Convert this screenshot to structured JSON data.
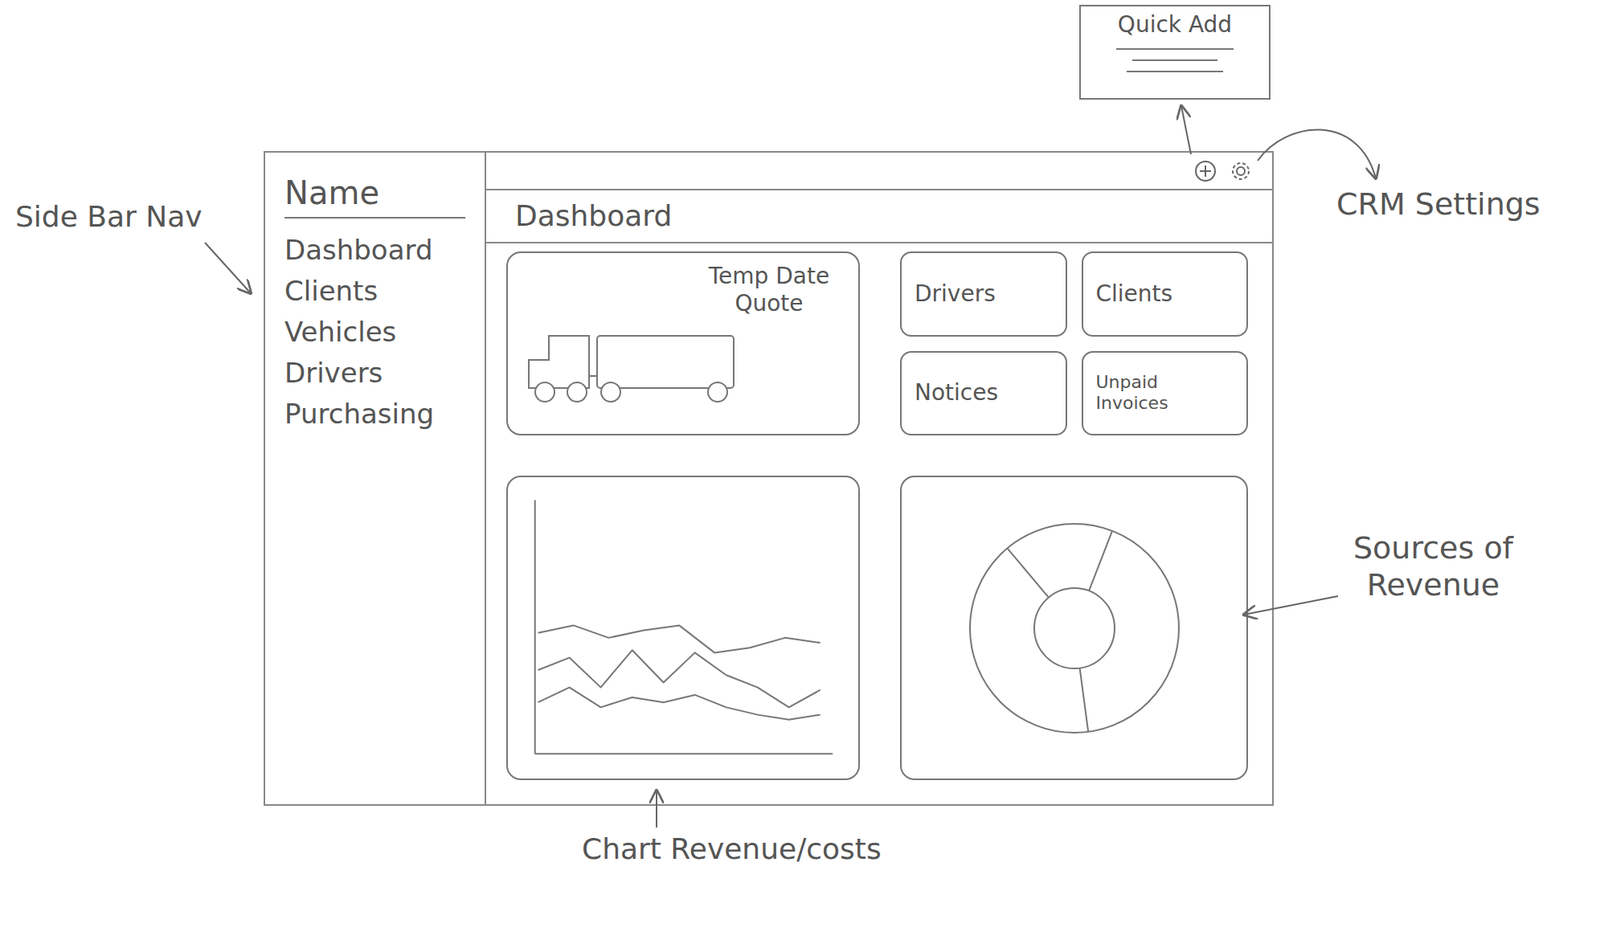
{
  "quick_add": {
    "title": "Quick Add"
  },
  "annotations": {
    "sidebar_nav": "Side Bar Nav",
    "crm_settings": "CRM Settings",
    "revenue_sources": "Sources of Revenue",
    "revenue_chart": "Chart Revenue/costs"
  },
  "sidebar": {
    "title": "Name",
    "items": [
      {
        "label": "Dashboard"
      },
      {
        "label": "Clients"
      },
      {
        "label": "Vehicles"
      },
      {
        "label": "Drivers"
      },
      {
        "label": "Purchasing"
      }
    ]
  },
  "header": {
    "title": "Dashboard"
  },
  "quote_card": {
    "title": "Temp Date Quote"
  },
  "stat_cards": [
    {
      "label": "Drivers"
    },
    {
      "label": "Clients"
    },
    {
      "label": "Notices"
    },
    {
      "label": "Unpaid Invoices"
    }
  ],
  "line_chart": {
    "series": [
      {
        "values": [
          48,
          51,
          46,
          49,
          51,
          40,
          42,
          46,
          44
        ]
      },
      {
        "values": [
          33,
          38,
          26,
          41,
          28,
          40,
          31,
          26,
          18,
          25
        ]
      },
      {
        "values": [
          20,
          26,
          18,
          22,
          20,
          23,
          18,
          15,
          13,
          15
        ]
      }
    ]
  },
  "donut_chart": {
    "segments": [
      17,
      42,
      41
    ]
  }
}
